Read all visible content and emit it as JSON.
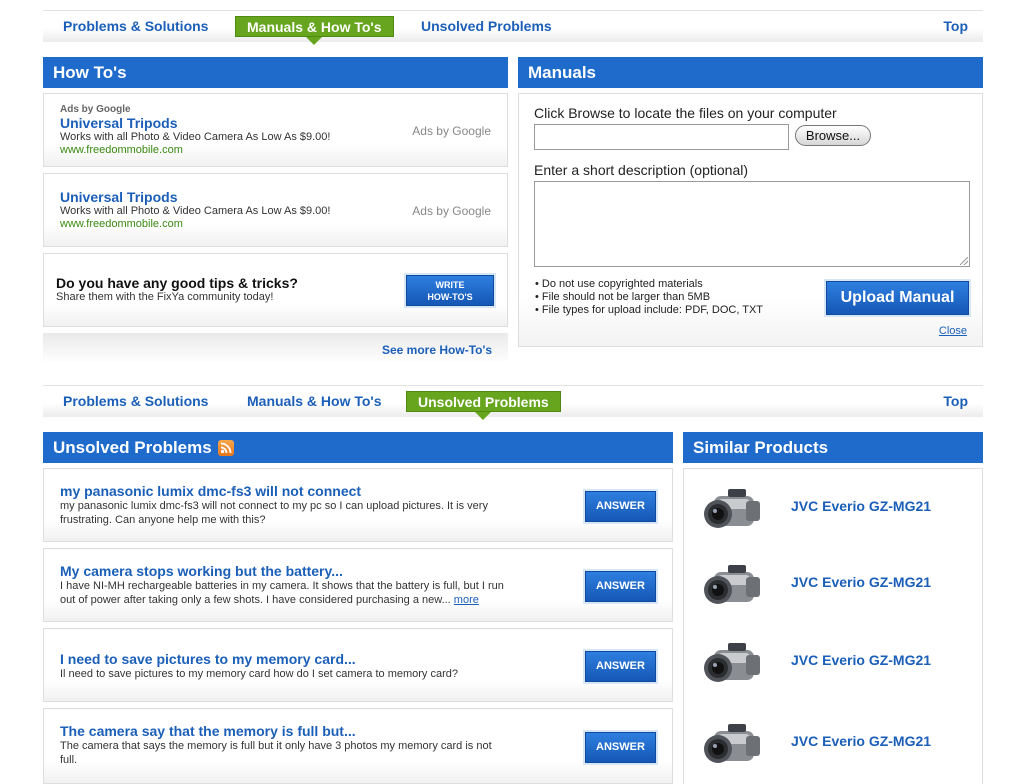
{
  "nav_top": {
    "problems": "Problems & Solutions",
    "manuals": "Manuals & How To's",
    "unsolved": "Unsolved Problems",
    "top": "Top"
  },
  "nav_bottom": {
    "problems": "Problems & Solutions",
    "manuals": "Manuals & How To's",
    "unsolved": "Unsolved Problems",
    "top": "Top"
  },
  "howtos": {
    "title": "How To's",
    "ads": [
      {
        "tag": "Ads by Google",
        "title": "Universal Tripods",
        "text": "Works with all Photo & Video Camera As Low As $9.00!",
        "url": "www.freedommobile.com",
        "by": "Ads by Google"
      },
      {
        "tag": "",
        "title": "Universal Tripods",
        "text": "Works with all Photo & Video Camera As Low As $9.00!",
        "url": "www.freedommobile.com",
        "by": "Ads by Google"
      }
    ],
    "tips": {
      "title": "Do you have any good tips & tricks?",
      "subtitle": "Share them with the FixYa community today!",
      "button_line1": "WRITE",
      "button_line2": "HOW-TO'S"
    },
    "see_more": "See more How-To's"
  },
  "manuals": {
    "title": "Manuals",
    "browse_label": "Click Browse to locate the files on your computer",
    "browse_button": "Browse...",
    "file_value": "",
    "description_label": "Enter a short description (optional)",
    "description_value": "",
    "rules": [
      "• Do not use copyrighted materials",
      "• File should not be larger than 5MB",
      "• File types for upload include: PDF, DOC, TXT"
    ],
    "upload_button": "Upload Manual",
    "close": "Close"
  },
  "unsolved": {
    "title": "Unsolved Problems",
    "answer_label": "ANSWER",
    "items": [
      {
        "title": "my panasonic lumix dmc-fs3 will not connect",
        "desc": "my panasonic lumix dmc-fs3 will not connect to my pc so I can upload pictures. It is very frustrating. Can anyone help me with this?",
        "more": ""
      },
      {
        "title": "My camera stops working but the battery...",
        "desc": "I have NI-MH rechargeable batteries in my camera. It shows that the battery is full, but I run out of power after taking only a few shots. I have considered purchasing a new...",
        "more": "more"
      },
      {
        "title": "I need to save pictures to my memory card...",
        "desc": "Il need to save pictures to my memory card how do I set camera to memory card?",
        "more": ""
      },
      {
        "title": "The camera say that the memory is full but...",
        "desc": "The camera that says the memory is full but it only have 3 photos my memory card is not full.",
        "more": ""
      }
    ]
  },
  "similar": {
    "title": "Similar Products",
    "products": [
      {
        "name": "JVC Everio GZ-MG21",
        "icon": "camcorder-icon"
      },
      {
        "name": "JVC Everio GZ-MG21",
        "icon": "camcorder-icon"
      },
      {
        "name": "JVC Everio GZ-MG21",
        "icon": "camcorder-icon"
      },
      {
        "name": "JVC Everio GZ-MG21",
        "icon": "camcorder-icon"
      }
    ]
  },
  "colors": {
    "header_blue": "#1e6bcc",
    "link_blue": "#1b5fb8",
    "active_green": "#66a51d",
    "ad_url_green": "#3a8a12"
  }
}
